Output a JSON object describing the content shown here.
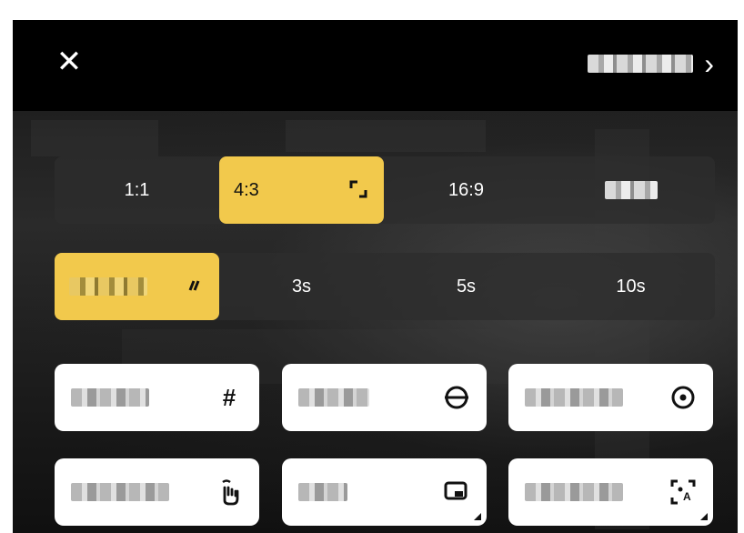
{
  "topbar": {
    "close_glyph": "✕",
    "next_label_redacted": "■■■■■",
    "chevron_glyph": "›"
  },
  "aspect_ratio": {
    "options": [
      {
        "label": "1:1",
        "selected": false
      },
      {
        "label": "4:3",
        "selected": true
      },
      {
        "label": "16:9",
        "selected": false
      },
      {
        "label": "■■■",
        "selected": false
      }
    ]
  },
  "timer": {
    "options": [
      {
        "label": "■■■■",
        "selected": true
      },
      {
        "label": "3s",
        "selected": false
      },
      {
        "label": "5s",
        "selected": false
      },
      {
        "label": "10s",
        "selected": false
      }
    ]
  },
  "tools": [
    {
      "label": "■■■■",
      "icon": "grid-icon",
      "glyph": "#"
    },
    {
      "label": "■■■■",
      "icon": "level-icon",
      "glyph": ""
    },
    {
      "label": "■■■■■",
      "icon": "focus-dot-icon",
      "glyph": ""
    },
    {
      "label": "■■■■■",
      "icon": "gesture-hand-icon",
      "glyph": ""
    },
    {
      "label": "■■■",
      "icon": "picture-in-picture-icon",
      "glyph": ""
    },
    {
      "label": "■■■■■",
      "icon": "auto-frame-icon",
      "glyph": ""
    }
  ],
  "colors": {
    "accent": "#f2c94c",
    "tile_bg": "#ffffff",
    "segment_bg": "#2d2d2d",
    "topbar_bg": "#000000"
  }
}
